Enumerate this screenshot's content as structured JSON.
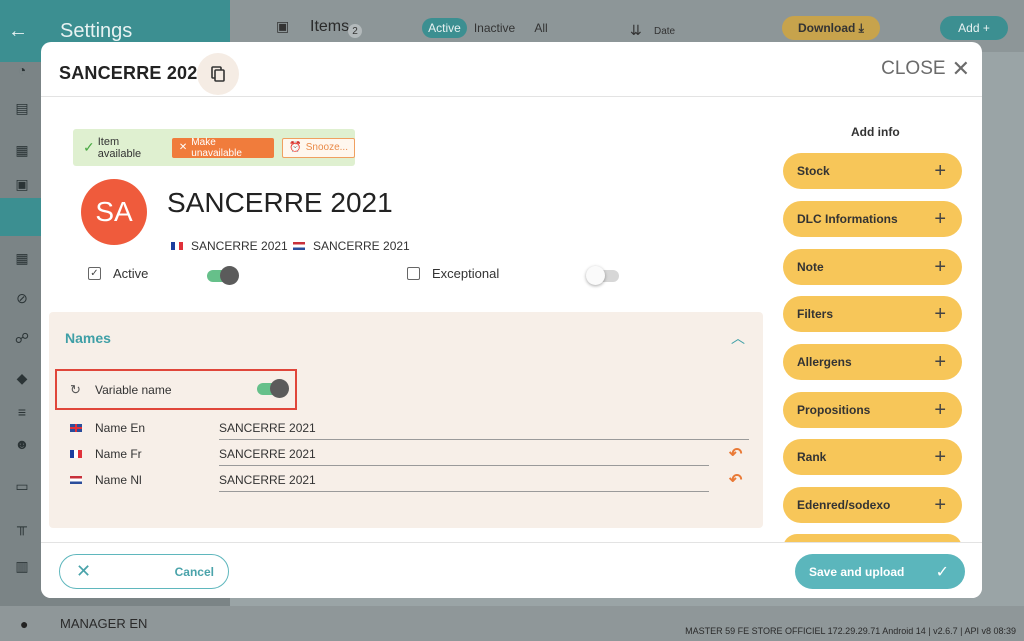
{
  "background": {
    "sidebar_title": "Settings",
    "topbar": {
      "items_label": "Items",
      "items_count": "2",
      "filters": [
        "Active",
        "Inactive",
        "All"
      ],
      "sort_label": "Date",
      "download_label": "Download",
      "add_label": "Add"
    },
    "manager": "MANAGER EN",
    "status_bar": "MASTER 59 FE STORE OFFICIEL   172.29.29.71  Android 14  | v2.6.7 | API v8     08:39"
  },
  "modal": {
    "title": "SANCERRE 2021",
    "close_label": "CLOSE",
    "availability": {
      "available_label": "Item available",
      "make_unavailable_label": "Make unavailable",
      "snooze_label": "Snooze..."
    },
    "avatar_initials": "SA",
    "product_name": "SANCERRE 2021",
    "translations": [
      {
        "lang": "fr",
        "name": "SANCERRE 2021"
      },
      {
        "lang": "nl",
        "name": "SANCERRE 2021"
      }
    ],
    "active_label": "Active",
    "active_checked": true,
    "active_toggle": true,
    "exceptional_label": "Exceptional",
    "exceptional_checked": false,
    "exceptional_toggle": false,
    "names_section": {
      "title": "Names",
      "variable_name_label": "Variable name",
      "variable_name_on": true,
      "rows": [
        {
          "flag": "en",
          "label": "Name En",
          "value": "SANCERRE 2021",
          "copy_arrow": false
        },
        {
          "flag": "fr",
          "label": "Name Fr",
          "value": "SANCERRE 2021",
          "copy_arrow": true
        },
        {
          "flag": "nl",
          "label": "Name Nl",
          "value": "SANCERRE 2021",
          "copy_arrow": true
        }
      ]
    },
    "add_info": {
      "title": "Add info",
      "items": [
        "Stock",
        "DLC Informations",
        "Note",
        "Filters",
        "Allergens",
        "Propositions",
        "Rank",
        "Edenred/sodexo"
      ]
    },
    "footer": {
      "cancel_label": "Cancel",
      "save_label": "Save and upload"
    }
  },
  "colors": {
    "teal": "#5bb6bc",
    "orange": "#f07c3c",
    "yellow": "#f7c659",
    "avatar": "#ef5b3c",
    "highlight_border": "#e0463a"
  }
}
